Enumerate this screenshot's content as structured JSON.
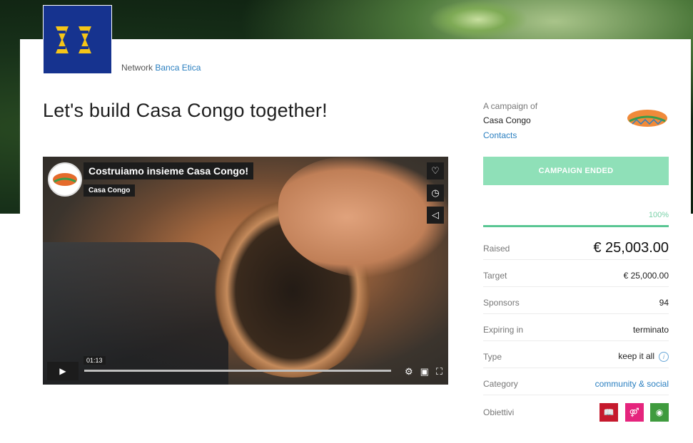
{
  "network": {
    "prefix": "Network",
    "link": "Banca Etica"
  },
  "page_title": "Let's build Casa Congo together!",
  "video": {
    "title": "Costruiamo insieme Casa Congo!",
    "channel": "Casa Congo",
    "time": "01:13",
    "progress_fraction": 0.0
  },
  "campaign": {
    "of_label": "A campaign of",
    "name": "Casa Congo",
    "contacts": "Contacts",
    "logo_text": "Casa Congo",
    "button": "CAMPAIGN ENDED",
    "percent": "100%",
    "progress_fraction": 1.0
  },
  "stats": {
    "raised": {
      "label": "Raised",
      "value": "€ 25,003.00"
    },
    "target": {
      "label": "Target",
      "value": "€ 25,000.00"
    },
    "sponsors": {
      "label": "Sponsors",
      "value": "94"
    },
    "expiring": {
      "label": "Expiring in",
      "value": "terminato"
    },
    "type": {
      "label": "Type",
      "value": "keep it all",
      "info": "i"
    },
    "category": {
      "label": "Category",
      "value": "community & social"
    },
    "goals": {
      "label": "Obiettivi",
      "icons": [
        "sdg-4-quality-education-icon",
        "sdg-5-gender-equality-icon",
        "sdg-15-life-on-land-icon"
      ]
    }
  },
  "colors": {
    "brand": "#16338f",
    "accent": "#f5c518",
    "button": "#8fe0b8",
    "progress": "#59c693",
    "link": "#2a7fc0"
  }
}
